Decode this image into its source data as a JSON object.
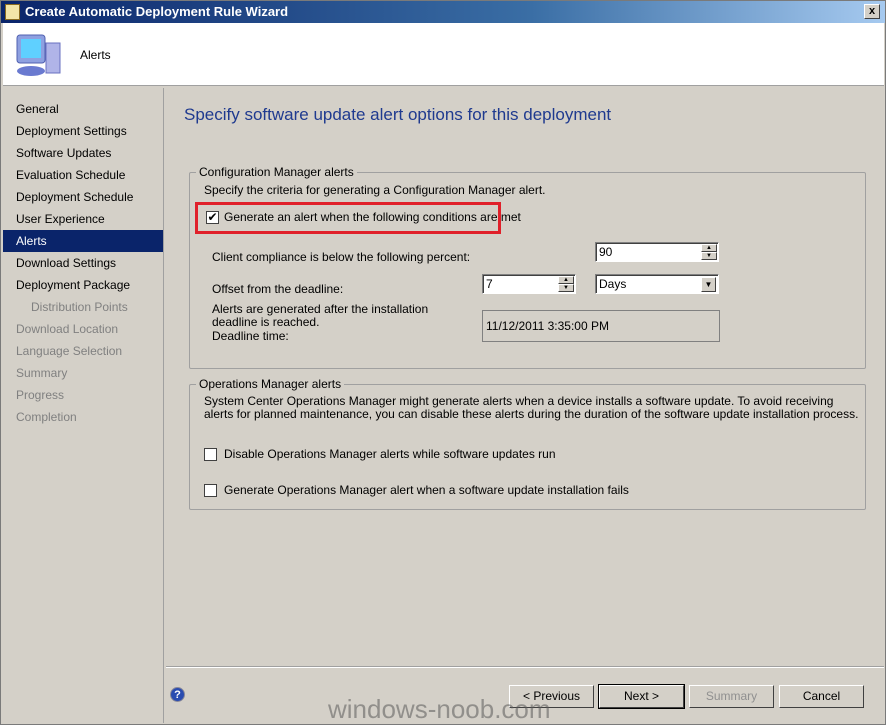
{
  "window": {
    "title": "Create Automatic Deployment Rule Wizard",
    "close": "x"
  },
  "header": {
    "title": "Alerts"
  },
  "sidebar": {
    "items": [
      {
        "label": "General",
        "state": "normal"
      },
      {
        "label": "Deployment Settings",
        "state": "normal"
      },
      {
        "label": "Software Updates",
        "state": "normal"
      },
      {
        "label": "Evaluation Schedule",
        "state": "normal"
      },
      {
        "label": "Deployment Schedule",
        "state": "normal"
      },
      {
        "label": "User Experience",
        "state": "normal"
      },
      {
        "label": "Alerts",
        "state": "selected"
      },
      {
        "label": "Download Settings",
        "state": "normal"
      },
      {
        "label": "Deployment Package",
        "state": "normal"
      },
      {
        "label": "Distribution Points",
        "state": "sub-disabled"
      },
      {
        "label": "Download Location",
        "state": "disabled"
      },
      {
        "label": "Language Selection",
        "state": "disabled"
      },
      {
        "label": "Summary",
        "state": "disabled"
      },
      {
        "label": "Progress",
        "state": "disabled"
      },
      {
        "label": "Completion",
        "state": "disabled"
      }
    ]
  },
  "main": {
    "title": "Specify software update alert options for this deployment",
    "cm": {
      "legend": "Configuration Manager alerts",
      "desc": "Specify the criteria for generating a Configuration Manager alert.",
      "generate_label": "Generate an alert when the following conditions are met",
      "generate_checked": true,
      "compliance_label": "Client compliance is below the  following percent:",
      "compliance_value": "90",
      "offset_label": "Offset from the deadline:",
      "offset_value": "7",
      "offset_unit": "Days",
      "after_label": "Alerts are generated after the installation deadline is reached.",
      "deadline_label": "Deadline time:",
      "deadline_value": "11/12/2011 3:35:00 PM"
    },
    "om": {
      "legend": "Operations Manager alerts",
      "desc": "System Center Operations Manager might generate alerts when a device installs a software update. To avoid receiving alerts for planned maintenance, you can disable these alerts during the duration of the software update installation process.",
      "disable_label": "Disable Operations Manager alerts while software updates run",
      "disable_checked": false,
      "generate_label": "Generate Operations Manager alert when a software update installation fails",
      "generate_checked": false
    }
  },
  "footer": {
    "help": "?",
    "previous": "< Previous",
    "next": "Next >",
    "summary": "Summary",
    "cancel": "Cancel"
  },
  "watermark": "windows-noob.com",
  "colors": {
    "accent": "#0a246a",
    "title": "#1f3a8f",
    "highlight": "#e0202a"
  }
}
